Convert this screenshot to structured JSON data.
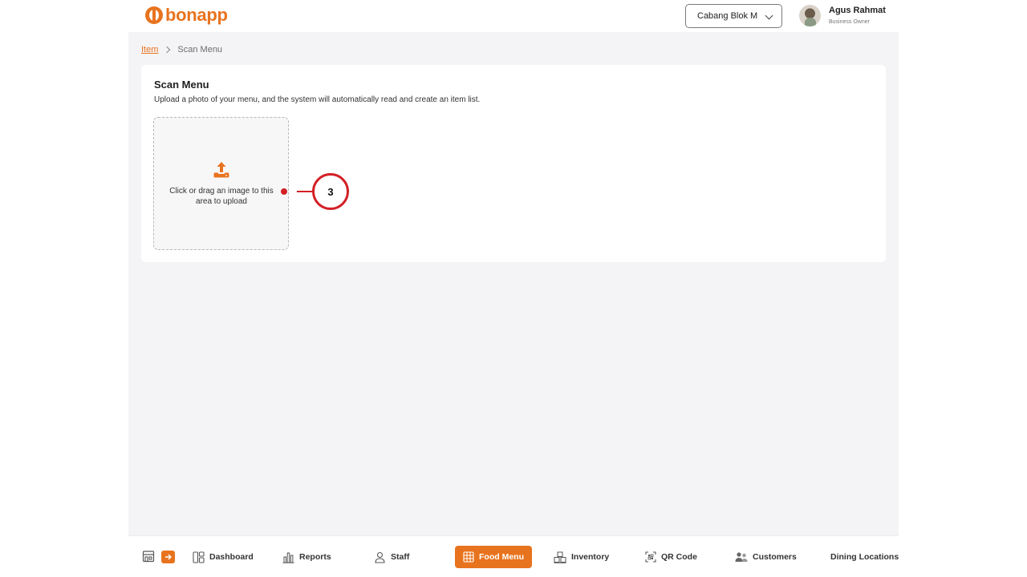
{
  "brand": {
    "name": "bonapp",
    "color": "#e8731e"
  },
  "header": {
    "branch": "Cabang Blok M",
    "user_name": "Agus Rahmat",
    "user_role": "Business Owner"
  },
  "breadcrumb": {
    "parent": "Item",
    "current": "Scan Menu"
  },
  "card": {
    "title": "Scan Menu",
    "description": "Upload a photo of your menu, and the system will automatically read and create an item list.",
    "dropzone_text": "Click or drag an image to this area to upload"
  },
  "annotation": {
    "number": "3",
    "color": "#d32026"
  },
  "bottom_nav": {
    "items": [
      {
        "label": "Dashboard",
        "icon": "dashboard-icon"
      },
      {
        "label": "Reports",
        "icon": "bar-chart-icon"
      },
      {
        "label": "Staff",
        "icon": "user-icon"
      },
      {
        "label": "Food Menu",
        "icon": "grid-menu-icon",
        "active": true
      },
      {
        "label": "Inventory",
        "icon": "boxes-icon"
      },
      {
        "label": "QR Code",
        "icon": "qr-code-icon"
      },
      {
        "label": "Customers",
        "icon": "customers-icon"
      },
      {
        "label": "Dining Locations",
        "icon": "dining-icon"
      }
    ]
  }
}
